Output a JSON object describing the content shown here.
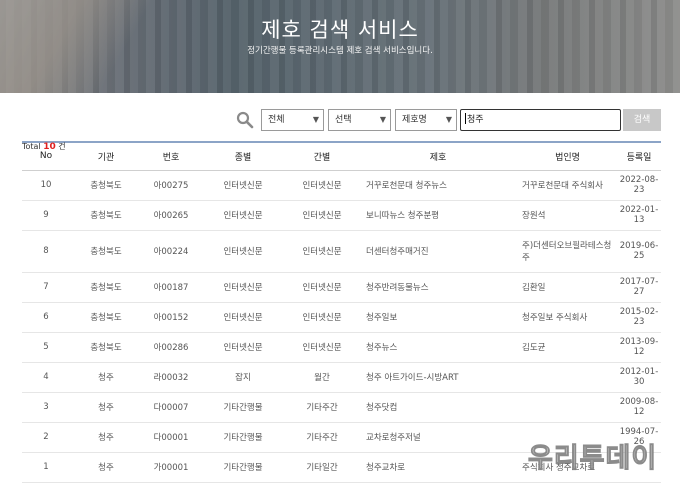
{
  "hero": {
    "title": "제호 검색 서비스",
    "subtitle": "정기간행물 등록관리시스템 제호 검색 서비스입니다."
  },
  "search": {
    "icon": "search-icon",
    "category": "전체",
    "type": "선택",
    "field": "제호명",
    "query": "청주",
    "button": "검색"
  },
  "total": {
    "prefix": "Total ",
    "count": "10",
    "suffix": " 건"
  },
  "table": {
    "headers": [
      "No",
      "기관",
      "번호",
      "종별",
      "간별",
      "제호",
      "법인명",
      "등록일"
    ],
    "rows": [
      [
        "10",
        "충청북도",
        "아00275",
        "인터넷신문",
        "인터넷신문",
        "거꾸로천문대 청주뉴스",
        "거꾸로천문대 주식회사",
        "2022-08-23"
      ],
      [
        "9",
        "충청북도",
        "아00265",
        "인터넷신문",
        "인터넷신문",
        "보니따뉴스 청주분평",
        "장원석",
        "2022-01-13"
      ],
      [
        "8",
        "충청북도",
        "아00224",
        "인터넷신문",
        "인터넷신문",
        "더센터청주매거진",
        "주)더센터오브필라테스청주",
        "2019-06-25"
      ],
      [
        "7",
        "충청북도",
        "아00187",
        "인터넷신문",
        "인터넷신문",
        "청주반려동물뉴스",
        "김환일",
        "2017-07-27"
      ],
      [
        "6",
        "충청북도",
        "아00152",
        "인터넷신문",
        "인터넷신문",
        "청주일보",
        "청주일보 주식회사",
        "2015-02-23"
      ],
      [
        "5",
        "충청북도",
        "아00286",
        "인터넷신문",
        "인터넷신문",
        "청주뉴스",
        "김도균",
        "2013-09-12"
      ],
      [
        "4",
        "청주",
        "라00032",
        "잡지",
        "월간",
        "청주 아트가이드-시방ART",
        "",
        "2012-01-30"
      ],
      [
        "3",
        "청주",
        "다00007",
        "기타간행물",
        "기타주간",
        "청주닷컴",
        "",
        "2009-08-12"
      ],
      [
        "2",
        "청주",
        "다00001",
        "기타간행물",
        "기타주간",
        "교차로청주저널",
        "",
        "1994-07-26"
      ],
      [
        "1",
        "청주",
        "가00001",
        "기타간행물",
        "기타일간",
        "청주교차로",
        "주식회사 청주교차로",
        ""
      ]
    ]
  },
  "watermark": "우리투데이"
}
